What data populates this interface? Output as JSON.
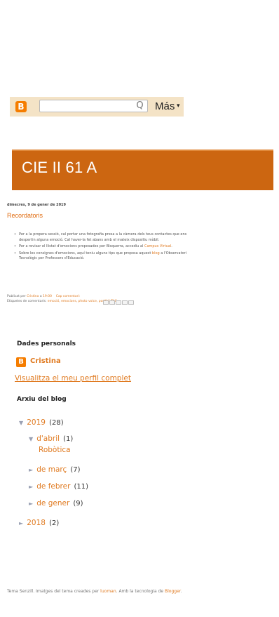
{
  "navbar": {
    "logo_letter": "B",
    "search_placeholder": "",
    "search_icon": "Q",
    "more_label": "Más",
    "more_arrow": "▾"
  },
  "header": {
    "title": "CIE II 61 A"
  },
  "post": {
    "date": "dimecres, 9 de gener de 2019",
    "title": "Recordatoris",
    "bullets": [
      {
        "text": "Per a la propera sessió, cal portar una fotografia presa a la càmera dels teus contactes que ens despertin alguna emoció. Cal haver-la fet abans amb el mateix dispositiu mòbil."
      },
      {
        "text": "Per a revisar el llistat d'emocions proposades per Bisquerra, accediu al ",
        "link": "Campus Virtual",
        "after": "."
      },
      {
        "text": "Sobre les consignes d'emocions, aquí teniu alguns tips que proposa aquest ",
        "link": "blog",
        "after": " a l'Observatori Tecnològic per Professors d'Educació."
      }
    ],
    "footer_published": "Publicat per",
    "footer_author": "Cristina",
    "footer_at": "a",
    "footer_time": "19:00",
    "footer_comments": "Cap comentari:",
    "footer_labels_prefix": "Etiquetes de comentaris:",
    "footer_labels": "emoció, emocions, photo voice, portfoli TAC"
  },
  "sidebar": {
    "profile_heading": "Dades personals",
    "profile_name": "Cristina",
    "profile_link": "Visualitza el meu perfil complet",
    "archive_heading": "Arxiu del blog",
    "archive": {
      "y2019": {
        "label": "2019",
        "count": "(28)",
        "arrow": "▼"
      },
      "april": {
        "label": "d'abril",
        "count": "(1)",
        "arrow": "▼"
      },
      "april_post": "Robòtica",
      "march": {
        "label": "de març",
        "count": "(7)",
        "arrow": "►"
      },
      "february": {
        "label": "de febrer",
        "count": "(11)",
        "arrow": "►"
      },
      "january": {
        "label": "de gener",
        "count": "(9)",
        "arrow": "►"
      },
      "y2018": {
        "label": "2018",
        "count": "(2)",
        "arrow": "►"
      }
    }
  },
  "footer": {
    "text1": "Tema Senzill. Imatges del tema creades per ",
    "link1": "luoman",
    "text2": ". Amb la tecnologia de ",
    "link2": "Blogger",
    "text3": "."
  },
  "colors": {
    "accent": "#e07b22",
    "header_bg": "#cc6611",
    "navbar_bg": "#f4e3c6"
  }
}
